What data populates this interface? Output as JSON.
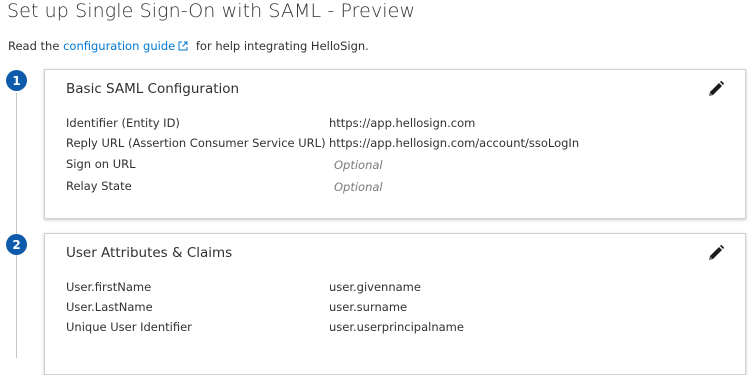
{
  "page": {
    "title": "Set up Single Sign-On with SAML - Preview"
  },
  "intro": {
    "prefix": "Read the",
    "link_text": "configuration guide",
    "suffix": "for help integrating HelloSign."
  },
  "steps": [
    {
      "number": "1",
      "title": "Basic SAML Configuration",
      "rows": [
        {
          "label": "Identifier (Entity ID)",
          "value": "https://app.hellosign.com",
          "optional": false
        },
        {
          "label": "Reply URL (Assertion Consumer Service URL)",
          "value": "https://app.hellosign.com/account/ssoLogIn",
          "optional": false
        },
        {
          "label": "Sign on URL",
          "value": "Optional",
          "optional": true
        },
        {
          "label": "Relay State",
          "value": "Optional",
          "optional": true
        }
      ]
    },
    {
      "number": "2",
      "title": "User Attributes & Claims",
      "rows": [
        {
          "label": "User.firstName",
          "value": "user.givenname",
          "optional": false
        },
        {
          "label": "User.LastName",
          "value": "user.surname",
          "optional": false
        },
        {
          "label": "Unique User Identifier",
          "value": "user.userprincipalname",
          "optional": false
        }
      ]
    }
  ],
  "colors": {
    "link": "#0078d4",
    "step_badge": "#0f5bab",
    "optional_text": "#7a7a7a"
  },
  "icons": {
    "edit": "pencil-icon",
    "external_link": "external-link-icon"
  }
}
